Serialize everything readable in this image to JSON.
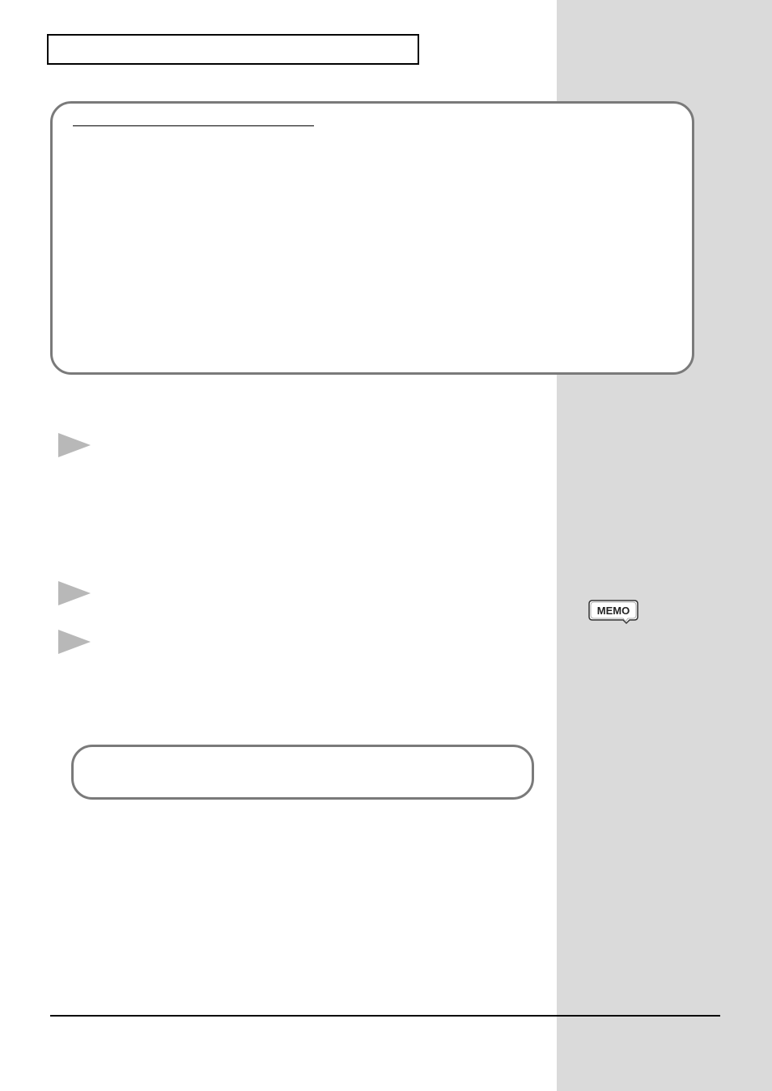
{
  "icons": {
    "memo_label": "MEMO"
  }
}
